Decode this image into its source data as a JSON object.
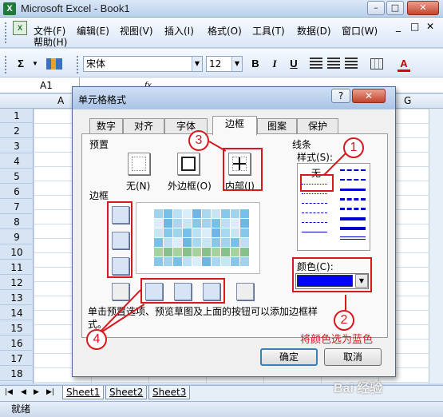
{
  "window": {
    "title": "Microsoft Excel - Book1",
    "min": "–",
    "max": "□",
    "close": "✕",
    "app_icon": "excel-icon"
  },
  "menu": {
    "items": [
      "文件(F)",
      "编辑(E)",
      "视图(V)",
      "插入(I)",
      "格式(O)",
      "工具(T)",
      "数据(D)",
      "窗口(W)"
    ],
    "help": "帮助(H)",
    "mdi": {
      "min": "_",
      "max": "□",
      "close": "✕"
    }
  },
  "toolbar": {
    "sum": "Σ",
    "font": "宋体",
    "size": "12",
    "bold": "B",
    "italic": "I",
    "underline": "U",
    "font_color": "A"
  },
  "formula": {
    "name_box": "A1",
    "fx": "fx"
  },
  "grid": {
    "columns": [
      "A",
      "G"
    ],
    "rows": [
      "1",
      "2",
      "3",
      "4",
      "5",
      "6",
      "7",
      "8",
      "9",
      "10",
      "11",
      "12",
      "13",
      "14",
      "15",
      "16",
      "17",
      "18"
    ]
  },
  "sheets": [
    "Sheet1",
    "Sheet2",
    "Sheet3"
  ],
  "status": "就绪",
  "watermark": "Bai 经验",
  "dialog": {
    "title": "单元格格式",
    "help": "?",
    "close": "✕",
    "tabs": [
      "数字",
      "对齐",
      "字体",
      "边框",
      "图案",
      "保护"
    ],
    "active_tab": "边框",
    "presets": {
      "label": "预置",
      "none": "无(N)",
      "outline": "外边框(O)",
      "inside": "内部(I)"
    },
    "border_label": "边框",
    "line": {
      "label": "线条",
      "style_label": "样式(S):",
      "none": "无"
    },
    "color": {
      "label": "颜色(C):",
      "value": "#0000ff"
    },
    "description": "单击预置选项、预览草图及上面的按钮可以添加边框样式。",
    "ok": "确定",
    "cancel": "取消"
  },
  "annotations": {
    "badges": [
      "1",
      "2",
      "3",
      "4"
    ],
    "note": "将颜色选为蓝色",
    "color": "#d8181e"
  }
}
